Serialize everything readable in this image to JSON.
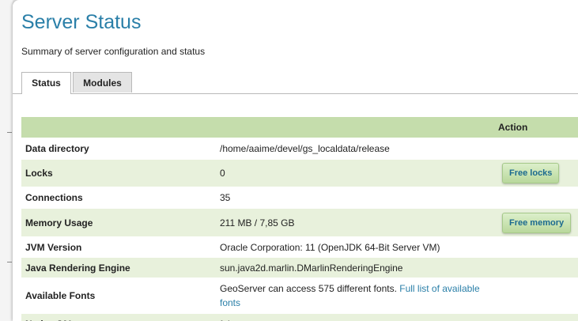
{
  "header": {
    "title": "Server Status",
    "subtitle": "Summary of server configuration and status"
  },
  "tabs": [
    {
      "label": "Status",
      "active": true
    },
    {
      "label": "Modules",
      "active": false
    }
  ],
  "table": {
    "action_header": "Action",
    "rows": [
      {
        "label": "Data directory",
        "value": "/home/aaime/devel/gs_localdata/release"
      },
      {
        "label": "Locks",
        "value": "0",
        "action": "Free locks"
      },
      {
        "label": "Connections",
        "value": "35"
      },
      {
        "label": "Memory Usage",
        "value": "211 MB / 7,85 GB",
        "action": "Free memory"
      },
      {
        "label": "JVM Version",
        "value": "Oracle Corporation: 11 (OpenJDK 64-Bit Server VM)"
      },
      {
        "label": "Java Rendering Engine",
        "value": "sun.java2d.marlin.DMarlinRenderingEngine"
      },
      {
        "label": "Available Fonts",
        "value": "GeoServer can access 575 different fonts.",
        "link": "Full list of available fonts"
      },
      {
        "label": "Native JAI",
        "value": "false"
      }
    ]
  },
  "colors": {
    "title": "#2a7fa8",
    "header_row": "#c5ddac",
    "alt_row": "#e8f1dc",
    "button": "#c9e3b1"
  }
}
